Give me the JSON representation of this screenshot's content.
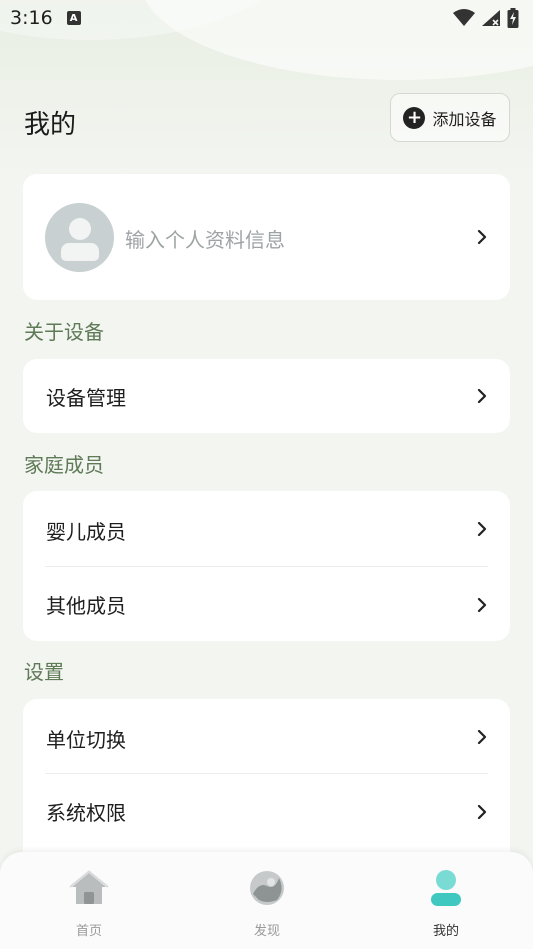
{
  "status_bar": {
    "time": "3:16",
    "notification_icon_letter": "A"
  },
  "header": {
    "title": "我的",
    "add_device_label": "添加设备"
  },
  "profile": {
    "prompt": "输入个人资料信息"
  },
  "sections": [
    {
      "title": "关于设备",
      "items": [
        {
          "label": "设备管理"
        }
      ]
    },
    {
      "title": "家庭成员",
      "items": [
        {
          "label": "婴儿成员"
        },
        {
          "label": "其他成员"
        }
      ]
    },
    {
      "title": "设置",
      "items": [
        {
          "label": "单位切换"
        },
        {
          "label": "系统权限"
        }
      ]
    }
  ],
  "tabbar": {
    "items": [
      {
        "label": "首页",
        "icon": "home-icon"
      },
      {
        "label": "发现",
        "icon": "discover-icon"
      },
      {
        "label": "我的",
        "icon": "user-icon",
        "active": true
      }
    ]
  },
  "colors": {
    "section_label": "#5f7a57",
    "active_tab_icon": "#4fcfc7",
    "inactive_tab_icon": "#b9bdbd"
  }
}
